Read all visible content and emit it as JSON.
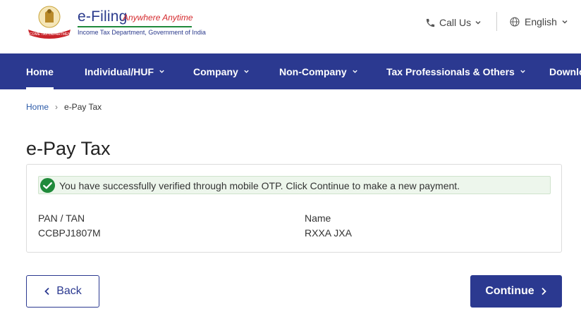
{
  "header": {
    "brand_title": "e-Filing",
    "brand_tagline": "Anywhere Anytime",
    "brand_sub": "Income Tax Department, Government of India",
    "call_us_label": "Call Us",
    "language_label": "English"
  },
  "nav": {
    "items": [
      {
        "label": "Home",
        "active": true
      },
      {
        "label": "Individual/HUF",
        "has_dropdown": true
      },
      {
        "label": "Company",
        "has_dropdown": true
      },
      {
        "label": "Non-Company",
        "has_dropdown": true
      },
      {
        "label": "Tax Professionals & Others",
        "has_dropdown": true
      },
      {
        "label": "Downlo"
      }
    ]
  },
  "breadcrumb": {
    "home": "Home",
    "separator": "›",
    "current": "e-Pay Tax"
  },
  "page": {
    "title": "e-Pay Tax"
  },
  "alert": {
    "message": "You have successfully verified through mobile OTP. Click Continue to make a new payment."
  },
  "details": {
    "pan_label": "PAN / TAN",
    "pan_value": "CCBPJ1807M",
    "name_label": "Name",
    "name_value": "RXXA JXA"
  },
  "actions": {
    "back_label": "Back",
    "continue_label": "Continue"
  },
  "colors": {
    "primary": "#2b3990",
    "success": "#1f8a3a",
    "accent_red": "#d4282c"
  },
  "icons": {
    "emblem": "emblem-logo",
    "phone": "phone-icon",
    "globe": "globe-icon",
    "success": "check-circle-icon"
  }
}
